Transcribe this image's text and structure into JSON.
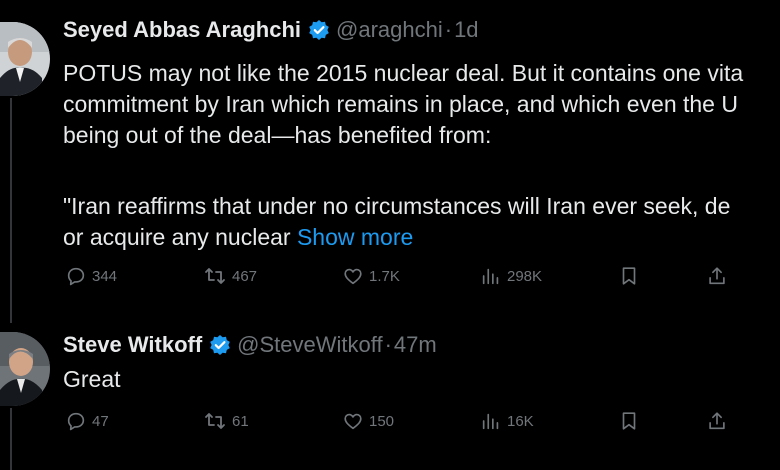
{
  "tweets": [
    {
      "author_name": "Seyed Abbas Araghchi",
      "handle": "@araghchi",
      "separator": "·",
      "time": "1d",
      "lines": [
        "POTUS may not like the 2015 nuclear deal. But it contains one vita",
        "commitment by Iran which remains in place, and which even the U",
        "being out of the deal—has benefited from:",
        "",
        "\"Iran reaffirms that under no circumstances will Iran ever seek, de"
      ],
      "last_line": "or acquire any nuclear ",
      "show_more": "Show more",
      "replies": "344",
      "reposts": "467",
      "likes": "1.7K",
      "views": "298K"
    },
    {
      "author_name": "Steve Witkoff",
      "handle": "@SteveWitkoff",
      "separator": "·",
      "time": "47m",
      "text": "Great",
      "replies": "47",
      "reposts": "61",
      "likes": "150",
      "views": "16K"
    }
  ],
  "colors": {
    "background": "#000000",
    "text": "#e7e9ea",
    "muted": "#71767b",
    "link": "#1d9bf0",
    "verified": "#1d9bf0"
  },
  "icons": [
    "verified-badge-icon",
    "reply-icon",
    "repost-icon",
    "like-icon",
    "views-icon",
    "bookmark-icon",
    "share-icon"
  ]
}
